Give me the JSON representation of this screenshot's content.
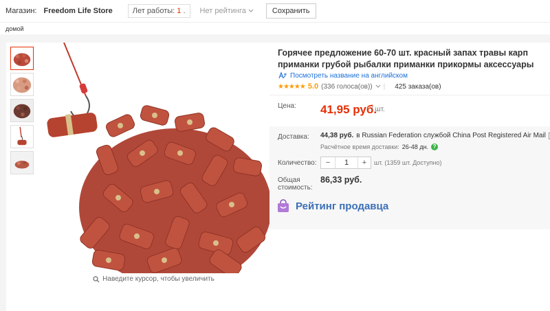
{
  "store_bar": {
    "store_label": "Магазин:",
    "store_name": "Freedom Life Store",
    "years_label": "Лет работы:",
    "years_value": "1",
    "rating_label": "Нет рейтинга",
    "save_button": "Сохранить"
  },
  "breadcrumb": "домой",
  "gallery": {
    "thumbnails": [
      "bait-red-heap",
      "bait-pink-heap",
      "bait-dark-heap",
      "hook-red-pellet",
      "bait-small-heap"
    ],
    "active_thumb": 0,
    "zoom_hint": "Наведите курсор, чтобы увеличить"
  },
  "product": {
    "title": "Горячее предложение 60-70 шт. красный запах травы карп приманки грубой рыбалки приманки прикормы аксессуары",
    "translate_link": "Посмотреть название на английском",
    "stars": "★★★★★",
    "rating": "5.0",
    "votes": "(336 голоса(ов))",
    "orders": "425 заказа(ов)"
  },
  "price": {
    "label": "Цена:",
    "value": "41,95 руб.",
    "unit": "/ шт."
  },
  "shipping": {
    "label": "Доставка:",
    "cost": "44,38 руб.",
    "detail": "в Russian Federation службой China Post Registered Air Mail",
    "eta_label": "Расчётное время доставки:",
    "eta_days": "26-48 дн."
  },
  "quantity": {
    "label": "Количество:",
    "value": "1",
    "unit_note": "шт. (1359 шт. Доступно)"
  },
  "total": {
    "label_line1": "Общая",
    "label_line2": "стоимость:",
    "value": "86,33 руб."
  },
  "seller_rating_title": "Рейтинг продавца",
  "colors": {
    "accent_price": "#e62e04",
    "link_blue": "#1a6ed8",
    "star_orange": "#ff9a00",
    "seller_blue": "#3b6fb6",
    "bag_purple": "#b07ad6"
  },
  "icons": {
    "translate": "translate-icon",
    "search": "search-icon",
    "chevron": "chevron-down-icon",
    "help": "question-icon",
    "bag": "shopping-bag-icon"
  }
}
